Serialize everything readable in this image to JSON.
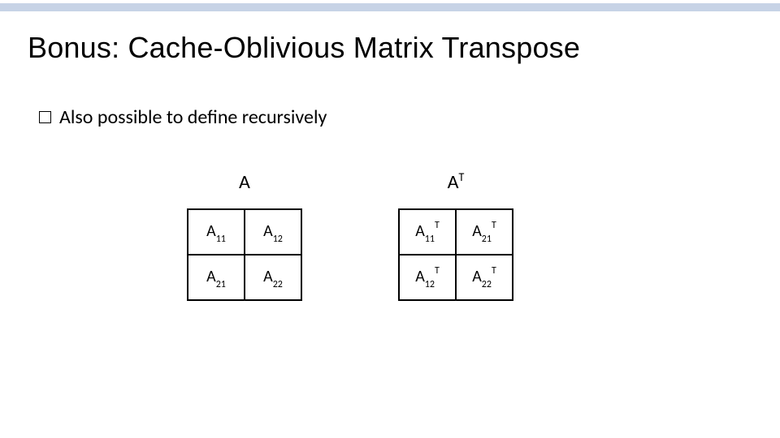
{
  "title": "Bonus: Cache-Oblivious Matrix Transpose",
  "bullet": "Also possible to define recursively",
  "matrices": {
    "A": {
      "label_base": "A",
      "label_sup": "",
      "cells": [
        {
          "base": "A",
          "sub": "11",
          "sup": ""
        },
        {
          "base": "A",
          "sub": "12",
          "sup": ""
        },
        {
          "base": "A",
          "sub": "21",
          "sup": ""
        },
        {
          "base": "A",
          "sub": "22",
          "sup": ""
        }
      ]
    },
    "AT": {
      "label_base": "A",
      "label_sup": "T",
      "cells": [
        {
          "base": "A",
          "sub": "11",
          "sup": "T"
        },
        {
          "base": "A",
          "sub": "21",
          "sup": "T"
        },
        {
          "base": "A",
          "sub": "12",
          "sup": "T"
        },
        {
          "base": "A",
          "sub": "22",
          "sup": "T"
        }
      ]
    }
  }
}
